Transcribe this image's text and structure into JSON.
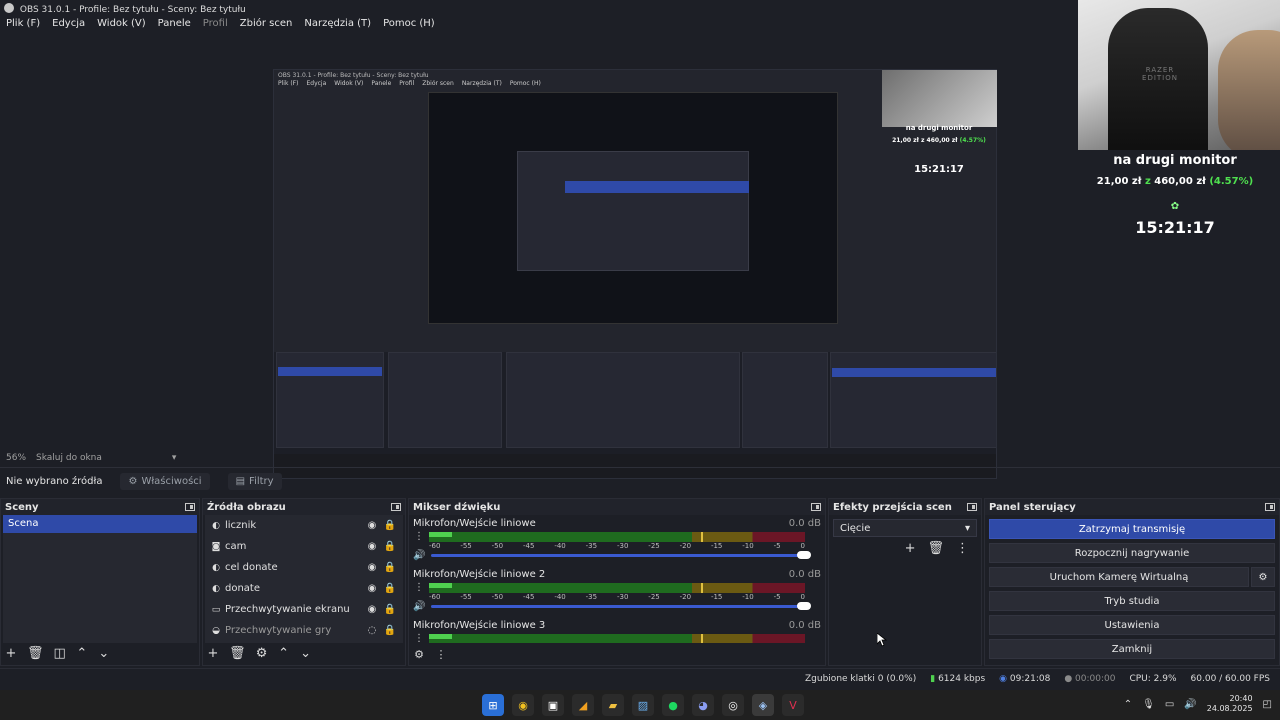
{
  "window": {
    "title": "OBS 31.0.1 - Profile: Bez tytułu - Sceny: Bez tytułu"
  },
  "menu": [
    "Plik (F)",
    "Edycja",
    "Widok (V)",
    "Panele",
    "Profil",
    "Zbiór scen",
    "Narzędzia (T)",
    "Pomoc (H)"
  ],
  "overlay": {
    "label": "na drugi monitor",
    "money_a": "21,00 zł",
    "money_sep": "z",
    "money_b": "460,00 zł",
    "pct": "(4.57%)",
    "time": "15:21:17"
  },
  "webcam_brand": "RAZER EDITION",
  "preview_status": {
    "zoom": "56%",
    "scale_mode": "Skaluj do okna"
  },
  "propbar": {
    "no_source": "Nie wybrano źródła",
    "properties": "Właściwości",
    "filters": "Filtry"
  },
  "scenes": {
    "title": "Sceny",
    "items": [
      "Scena"
    ]
  },
  "sources": {
    "title": "Źródła obrazu",
    "items": [
      {
        "name": "licznik",
        "icon": "globe-icon"
      },
      {
        "name": "cam",
        "icon": "camera-icon"
      },
      {
        "name": "cel donate",
        "icon": "globe-icon"
      },
      {
        "name": "donate",
        "icon": "globe-icon"
      },
      {
        "name": "Przechwytywanie ekranu",
        "icon": "monitor-icon"
      },
      {
        "name": "Przechwytywanie gry",
        "icon": "gamepad-icon"
      }
    ]
  },
  "mixer": {
    "title": "Mikser dźwięku",
    "ticks": [
      "-60",
      "-55",
      "-50",
      "-45",
      "-40",
      "-35",
      "-30",
      "-25",
      "-20",
      "-15",
      "-10",
      "-5",
      "0"
    ],
    "channels": [
      {
        "name": "Mikrofon/Wejście liniowe",
        "db": "0.0 dB"
      },
      {
        "name": "Mikrofon/Wejście liniowe 2",
        "db": "0.0 dB"
      },
      {
        "name": "Mikrofon/Wejście liniowe 3",
        "db": "0.0 dB"
      }
    ]
  },
  "transitions": {
    "title": "Efekty przejścia scen",
    "selected": "Cięcie"
  },
  "controls": {
    "title": "Panel sterujący",
    "stop_stream": "Zatrzymaj transmisję",
    "start_record": "Rozpocznij nagrywanie",
    "virtual_cam": "Uruchom Kamerę Wirtualną",
    "studio_mode": "Tryb studia",
    "settings": "Ustawienia",
    "exit": "Zamknij"
  },
  "status": {
    "dropped": "Zgubione klatki 0 (0.0%)",
    "bitrate": "6124 kbps",
    "stream_time": "09:21:08",
    "rec_time": "00:00:00",
    "cpu": "CPU: 2.9%",
    "fps": "60.00 / 60.00 FPS"
  },
  "taskbar": {
    "time": "20:40",
    "date": "24.08.2025"
  },
  "colors": {
    "accent": "#2f4aa8",
    "background": "#1d1f26",
    "meter_green": "#4fd14f",
    "pct_green": "#4fe04f"
  }
}
